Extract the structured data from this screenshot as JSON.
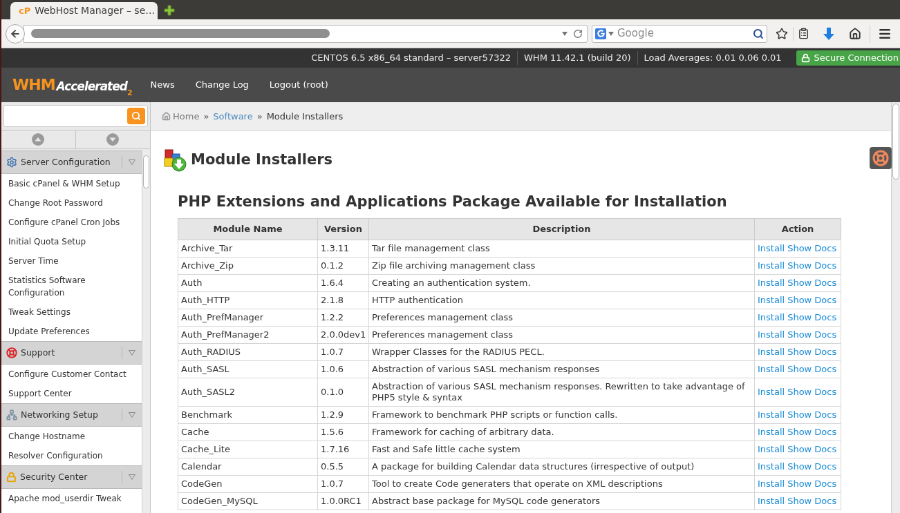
{
  "browser": {
    "tab": {
      "favicon": "cP",
      "title": "WebHost Manager – se…",
      "selected": true
    },
    "search": {
      "placeholder": "Google"
    }
  },
  "status_bar": {
    "items": [
      "CENTOS 6.5 x86_64 standard – server57322",
      "WHM 11.42.1 (build 20)",
      "Load Averages: 0.01 0.06 0.01"
    ],
    "secure": "Secure Connection"
  },
  "header": {
    "logo": {
      "brand": "WHM",
      "product": "Accelerated",
      "version": "2"
    },
    "nav": [
      "News",
      "Change Log",
      "Logout (root)"
    ]
  },
  "sidebar": {
    "sections": [
      {
        "title": "Server Configuration",
        "expanded": true,
        "items": [
          "Basic cPanel & WHM Setup",
          "Change Root Password",
          "Configure cPanel Cron Jobs",
          "Initial Quota Setup",
          "Server Time",
          "Statistics Software Configuration",
          "Tweak Settings",
          "Update Preferences"
        ]
      },
      {
        "title": "Support",
        "expanded": true,
        "items": [
          "Configure Customer Contact",
          "Support Center"
        ]
      },
      {
        "title": "Networking Setup",
        "expanded": true,
        "items": [
          "Change Hostname",
          "Resolver Configuration"
        ]
      },
      {
        "title": "Security Center",
        "expanded": true,
        "items": [
          "Apache mod_userdir Tweak"
        ]
      }
    ]
  },
  "breadcrumb": {
    "separator": "»",
    "items": [
      {
        "label": "Home",
        "kind": "home"
      },
      {
        "label": "Software",
        "kind": "link"
      },
      {
        "label": "Module Installers",
        "kind": "current"
      }
    ]
  },
  "page": {
    "title": "Module Installers",
    "subtitle": "PHP Extensions and Applications Package Available for Installation"
  },
  "table": {
    "columns": [
      "Module Name",
      "Version",
      "Description",
      "Action"
    ],
    "rows": [
      {
        "name": "Archive_Tar",
        "version": "1.3.11",
        "description": "Tar file management class",
        "actions": [
          "Install",
          "Show Docs"
        ]
      },
      {
        "name": "Archive_Zip",
        "version": "0.1.2",
        "description": "Zip file archiving management class",
        "actions": [
          "Install",
          "Show Docs"
        ]
      },
      {
        "name": "Auth",
        "version": "1.6.4",
        "description": "Creating an authentication system.",
        "actions": [
          "Install",
          "Show Docs"
        ]
      },
      {
        "name": "Auth_HTTP",
        "version": "2.1.8",
        "description": "HTTP authentication",
        "actions": [
          "Install",
          "Show Docs"
        ]
      },
      {
        "name": "Auth_PrefManager",
        "version": "1.2.2",
        "description": "Preferences management class",
        "actions": [
          "Install",
          "Show Docs"
        ]
      },
      {
        "name": "Auth_PrefManager2",
        "version": "2.0.0dev1",
        "description": "Preferences management class",
        "actions": [
          "Install",
          "Show Docs"
        ]
      },
      {
        "name": "Auth_RADIUS",
        "version": "1.0.7",
        "description": "Wrapper Classes for the RADIUS PECL.",
        "actions": [
          "Install",
          "Show Docs"
        ]
      },
      {
        "name": "Auth_SASL",
        "version": "1.0.6",
        "description": "Abstraction of various SASL mechanism responses",
        "actions": [
          "Install",
          "Show Docs"
        ]
      },
      {
        "name": "Auth_SASL2",
        "version": "0.1.0",
        "description": "Abstraction of various SASL mechanism responses. Rewritten to take advantage of PHP5 style & syntax",
        "actions": [
          "Install",
          "Show Docs"
        ]
      },
      {
        "name": "Benchmark",
        "version": "1.2.9",
        "description": "Framework to benchmark PHP scripts or function calls.",
        "actions": [
          "Install",
          "Show Docs"
        ]
      },
      {
        "name": "Cache",
        "version": "1.5.6",
        "description": "Framework for caching of arbitrary data.",
        "actions": [
          "Install",
          "Show Docs"
        ]
      },
      {
        "name": "Cache_Lite",
        "version": "1.7.16",
        "description": "Fast and Safe little cache system",
        "actions": [
          "Install",
          "Show Docs"
        ]
      },
      {
        "name": "Calendar",
        "version": "0.5.5",
        "description": "A package for building Calendar data structures (irrespective of output)",
        "actions": [
          "Install",
          "Show Docs"
        ]
      },
      {
        "name": "CodeGen",
        "version": "1.0.7",
        "description": "Tool to create Code generaters that operate on XML descriptions",
        "actions": [
          "Install",
          "Show Docs"
        ]
      },
      {
        "name": "CodeGen_MySQL",
        "version": "1.0.0RC1",
        "description": "Abstract base package for MySQL code generators",
        "actions": [
          "Install",
          "Show Docs"
        ]
      }
    ]
  }
}
